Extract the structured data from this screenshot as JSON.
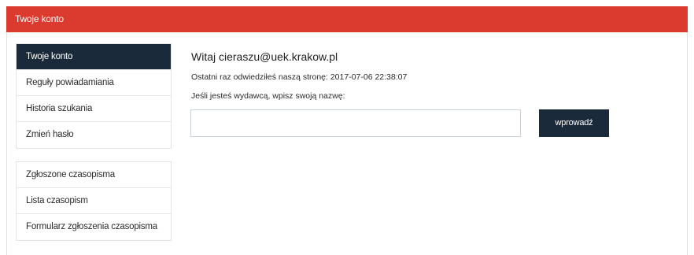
{
  "header": {
    "title": "Twoje konto"
  },
  "sidebar": {
    "account_menu": [
      {
        "label": "Twoje konto",
        "active": true
      },
      {
        "label": "Reguły powiadamiania",
        "active": false
      },
      {
        "label": "Historia szukania",
        "active": false
      },
      {
        "label": "Zmień hasło",
        "active": false
      }
    ],
    "journal_menu": [
      {
        "label": "Zgłoszone czasopisma",
        "active": false
      },
      {
        "label": "Lista czasopism",
        "active": false
      },
      {
        "label": "Formularz zgłoszenia czasopisma",
        "active": false
      }
    ]
  },
  "main": {
    "welcome": "Witaj cieraszu@uek.krakow.pl",
    "last_visit": "Ostatni raz odwiedziłeś naszą stronę: 2017-07-06 22:38:07",
    "publisher_label": "Jeśli jesteś wydawcą, wpisz swoją nazwę:",
    "publisher_value": "",
    "submit_label": "wprowadź"
  },
  "colors": {
    "header_bg": "#db3b2e",
    "active_bg": "#1b2a3a",
    "button_bg": "#1b2a3a"
  }
}
